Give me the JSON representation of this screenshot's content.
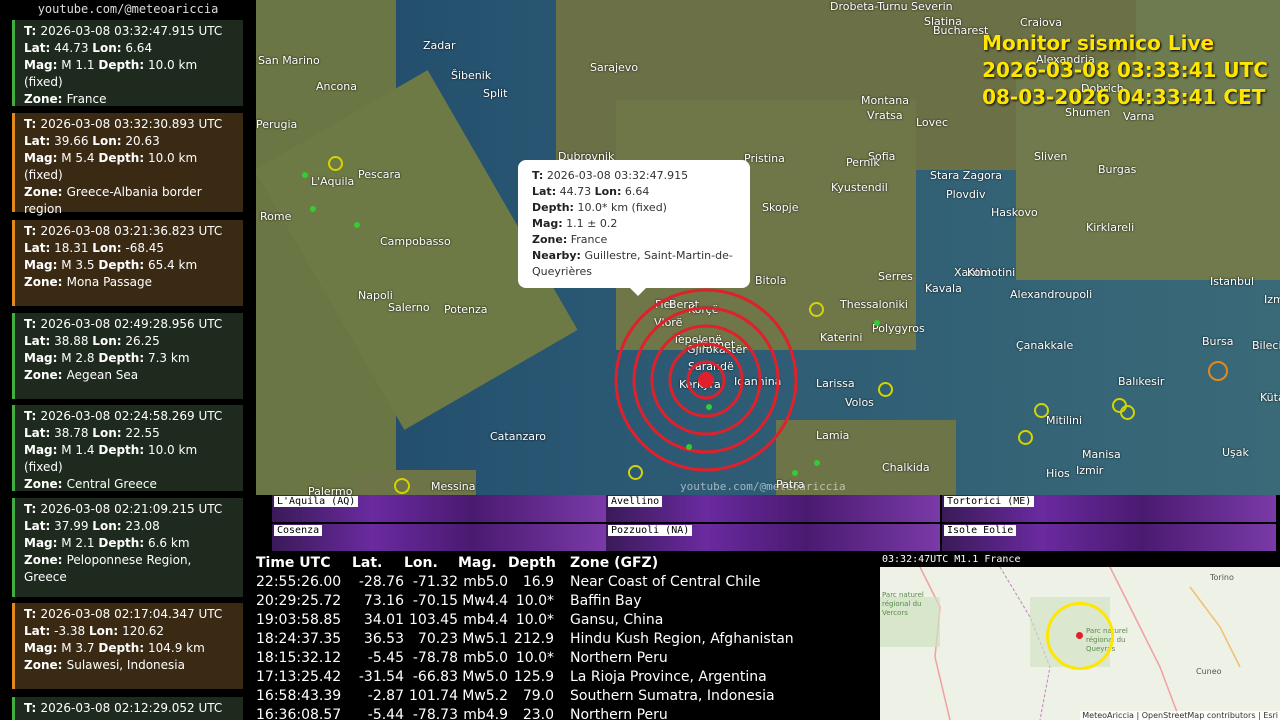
{
  "channel": "youtube.com/@meteoariccia",
  "overlay": {
    "title": "Monitor sismico Live",
    "utc_line": "2026-03-08  03:33:41  UTC",
    "cet_line": "08-03-2026  04:33:41  CET"
  },
  "events": [
    {
      "t": "2026-03-08  03:32:47.915 UTC",
      "lat": "44.73",
      "lon": "6.64",
      "mag": "M 1.1",
      "depth": "10.0 km (fixed)",
      "zone": "France",
      "color": "green"
    },
    {
      "t": "2026-03-08  03:32:30.893 UTC",
      "lat": "39.66",
      "lon": "20.63",
      "mag": "M 5.4",
      "depth": "10.0 km (fixed)",
      "zone": "Greece-Albania border region",
      "color": "orange"
    },
    {
      "t": "2026-03-08  03:21:36.823 UTC",
      "lat": "18.31",
      "lon": "-68.45",
      "mag": "M 3.5",
      "depth": "65.4 km",
      "zone": "Mona Passage",
      "color": "orange"
    },
    {
      "t": "2026-03-08  02:49:28.956 UTC",
      "lat": "38.88",
      "lon": "26.25",
      "mag": "M 2.8",
      "depth": "7.3 km",
      "zone": "Aegean Sea",
      "color": "green"
    },
    {
      "t": "2026-03-08  02:24:58.269 UTC",
      "lat": "38.78",
      "lon": "22.55",
      "mag": "M 1.4",
      "depth": "10.0 km (fixed)",
      "zone": "Central Greece",
      "color": "green"
    },
    {
      "t": "2026-03-08  02:21:09.215 UTC",
      "lat": "37.99",
      "lon": "23.08",
      "mag": "M 2.1",
      "depth": "6.6 km",
      "zone": "Peloponnese Region, Greece",
      "color": "green"
    },
    {
      "t": "2026-03-08  02:17:04.347 UTC",
      "lat": "-3.38",
      "lon": "120.62",
      "mag": "M 3.7",
      "depth": "104.9 km",
      "zone": "Sulawesi, Indonesia",
      "color": "orange"
    },
    {
      "t": "2026-03-08  02:12:29.052 UTC",
      "lat": "",
      "lon": "",
      "mag": "",
      "depth": "",
      "zone": "",
      "color": "green"
    }
  ],
  "popup": {
    "t": "2026-03-08  03:32:47.915",
    "lat": "44.73",
    "lon": "6.64",
    "depth": "10.0* km (fixed)",
    "mag": "1.1 ± 0.2",
    "zone": "France",
    "nearby": "Guillestre, Saint-Martin-de-Queyrières"
  },
  "map_labels": [
    "Zadar",
    "San Marino",
    "Šibenik",
    "Split",
    "Sarajevo",
    "Perugia",
    "Ancona",
    "Pescara",
    "L'Aquila",
    "Rome",
    "Campobasso",
    "Napoli",
    "Salerno",
    "Potenza",
    "Catanzaro",
    "Palermo",
    "Messina",
    "Dubrovnik",
    "Skopje",
    "Pristina",
    "Bitola",
    "Thessaloniki",
    "Polygyros",
    "Katerini",
    "Larissa",
    "Volos",
    "Lamia",
    "Chalkida",
    "Patra",
    "Montana",
    "Vratsa",
    "Lovec",
    "Sofia",
    "Pernik",
    "Kyustendil",
    "Plovdiv",
    "Stara Zagora",
    "Sliven",
    "Burgas",
    "Haskovo",
    "Kirklareli",
    "Xanthi",
    "Komotini",
    "Kavala",
    "Alexandroupoli",
    "Serres",
    "Istanbul",
    "Izmit",
    "Bursa",
    "Bilecik",
    "Çanakkale",
    "Balıkesir",
    "Kütahya",
    "Mitilini",
    "Izmir",
    "Manisa",
    "Uşak",
    "Hios",
    "Drobeta-Turnu Severin",
    "Slatina",
    "Bucharest",
    "Craiova",
    "Alexandria",
    "Shumen",
    "Varna",
    "Dobrich",
    "Vlorë",
    "Sarandë",
    "Ioannina",
    "Fier",
    "Berat",
    "Korçë",
    "Gjirokastër",
    "Tepelenë",
    "Përmet",
    "Kerkyra"
  ],
  "spectro": [
    "L'Aquila (AQ)",
    "Avellino",
    "Tortorici (ME)",
    "Cosenza",
    "Pozzuoli (NA)",
    "Isole Eolie"
  ],
  "table": {
    "headers": [
      "Time UTC",
      "Lat.",
      "Lon.",
      "Mag.",
      "Depth",
      "Zone (GFZ)"
    ],
    "rows": [
      [
        "22:55:26.00",
        "-28.76",
        "-71.32",
        "mb5.0",
        "16.9",
        "Near Coast of Central Chile"
      ],
      [
        "20:29:25.72",
        "73.16",
        "-70.15",
        "Mw4.4",
        "10.0*",
        "Baffin Bay"
      ],
      [
        "19:03:58.85",
        "34.01",
        "103.45",
        "mb4.4",
        "10.0*",
        "Gansu, China"
      ],
      [
        "18:24:37.35",
        "36.53",
        "70.23",
        "Mw5.1",
        "212.9",
        "Hindu Kush Region, Afghanistan"
      ],
      [
        "18:15:32.12",
        "-5.45",
        "-78.78",
        "mb5.0",
        "10.0*",
        "Northern Peru"
      ],
      [
        "17:13:25.42",
        "-31.54",
        "-66.83",
        "Mw5.0",
        "125.9",
        "La Rioja Province, Argentina"
      ],
      [
        "16:58:43.39",
        "-2.87",
        "101.74",
        "Mw5.2",
        "79.0",
        "Southern Sumatra, Indonesia"
      ],
      [
        "16:36:08.57",
        "-5.44",
        "-78.73",
        "mb4.9",
        "23.0",
        "Northern Peru"
      ]
    ]
  },
  "minimap": {
    "header": "03:32:47UTC   M1.1   France",
    "labels": [
      "Torino",
      "Cuneo",
      "Parc naturel régional du Vercors",
      "Parc naturel régional du Queyras"
    ],
    "attribution": "MeteoAriccia | OpenStreetMap contributors | Esri"
  },
  "watermark": "youtube.com/@meteoariccia"
}
